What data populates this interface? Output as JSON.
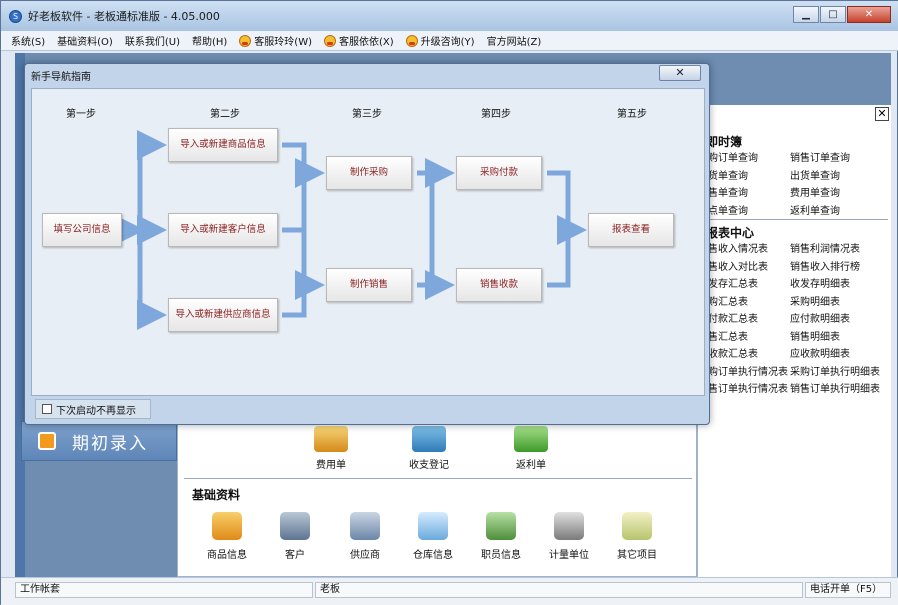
{
  "window": {
    "title": "好老板软件 - 老板通标准版 - 4.05.000"
  },
  "title_buttons": {
    "minimize": "▁",
    "maximize": "□",
    "close": "✕"
  },
  "menu": [
    {
      "label": "系统(S)",
      "icon": ""
    },
    {
      "label": "基础资料(O)",
      "icon": ""
    },
    {
      "label": "联系我们(U)",
      "icon": ""
    },
    {
      "label": "帮助(H)",
      "icon": ""
    },
    {
      "label": "客服玲玲(W)",
      "icon": "support-agent-icon"
    },
    {
      "label": "客服依依(X)",
      "icon": "support-agent-icon"
    },
    {
      "label": "升级咨询(Y)",
      "icon": "support-agent-icon"
    },
    {
      "label": "官方网站(Z)",
      "icon": ""
    }
  ],
  "dialog": {
    "title": "新手导航指南",
    "close_label": "✕",
    "steps": [
      "第一步",
      "第二步",
      "第三步",
      "第四步",
      "第五步"
    ],
    "boxes": {
      "company": "填写公司信息",
      "goods": "导入或新建商品信息",
      "customer": "导入或新建客户信息",
      "supplier": "导入或新建供应商信息",
      "purchase": "制作采购",
      "sales": "制作销售",
      "payment": "采购付款",
      "receipt": "销售收款",
      "report": "报表查看"
    },
    "no_show_label": "下次启动不再显示",
    "no_show_checked": false
  },
  "left_panel": {
    "initial_entry_label": "期初录入"
  },
  "center_panel": {
    "actions": [
      {
        "label": "费用单",
        "icon": "expense-icon"
      },
      {
        "label": "收支登记",
        "icon": "income-expense-icon"
      },
      {
        "label": "返利单",
        "icon": "rebate-icon"
      }
    ],
    "basic_title": "基础资料",
    "basic_items": [
      {
        "label": "商品信息",
        "icon": "goods-icon"
      },
      {
        "label": "客户",
        "icon": "customer-icon"
      },
      {
        "label": "供应商",
        "icon": "supplier-icon"
      },
      {
        "label": "仓库信息",
        "icon": "warehouse-icon"
      },
      {
        "label": "职员信息",
        "icon": "staff-icon"
      },
      {
        "label": "计量单位",
        "icon": "scale-icon"
      },
      {
        "label": "其它项目",
        "icon": "other-items-icon"
      }
    ]
  },
  "right_panel": {
    "close_label": "✕",
    "query_title": "即时簿",
    "query_links": [
      "采购订单查询",
      "销售订单查询",
      "进货单查询",
      "出货单查询",
      "代售单查询",
      "费用单查询",
      "盘点单查询",
      "返利单查询"
    ],
    "report_title": "报表中心",
    "report_links": [
      "销售收入情况表",
      "销售利润情况表",
      "销售收入对比表",
      "销售收入排行榜",
      "收发存汇总表",
      "收发存明细表",
      "采购汇总表",
      "采购明细表",
      "应付款汇总表",
      "应付款明细表",
      "销售汇总表",
      "销售明细表",
      "应收款汇总表",
      "应收款明细表",
      "采购订单执行情况表",
      "采购订单执行明细表",
      "销售订单执行情况表",
      "销售订单执行明细表"
    ]
  },
  "statusbar": {
    "account": "工作帐套",
    "user": "老板",
    "phone": "电话开单（F5）"
  },
  "colors": {
    "accent": "#2f6fc4",
    "flow_arrow": "#7ea8dc",
    "box_text": "#8a1e1e",
    "panel_bg": "#6e8db1"
  }
}
